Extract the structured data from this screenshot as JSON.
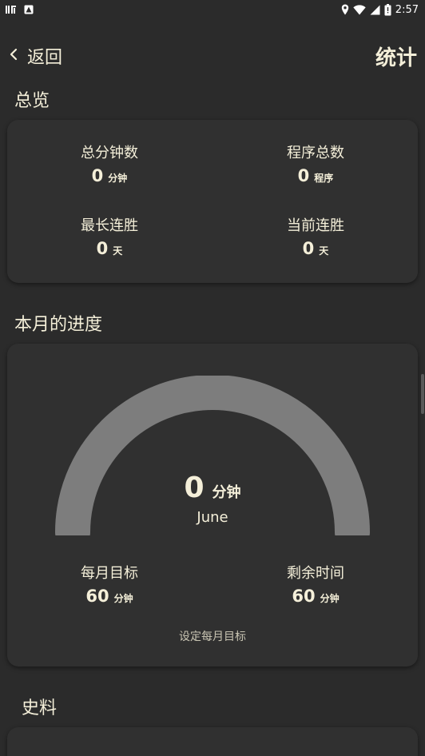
{
  "status_bar": {
    "time": "2:57",
    "left_icons": [
      "listen-app-icon",
      "notification-icon"
    ],
    "right_icons": [
      "location-icon",
      "wifi-icon",
      "signal-icon",
      "battery-icon"
    ]
  },
  "top_bar": {
    "back_label": "返回",
    "title": "统计"
  },
  "overview": {
    "heading": "总览",
    "stats": [
      {
        "label": "总分钟数",
        "value": "0",
        "unit": "分钟"
      },
      {
        "label": "程序总数",
        "value": "0",
        "unit": "程序"
      },
      {
        "label": "最长连胜",
        "value": "0",
        "unit": "天"
      },
      {
        "label": "当前连胜",
        "value": "0",
        "unit": "天"
      }
    ]
  },
  "monthly_progress": {
    "heading": "本月的进度",
    "gauge": {
      "value": "0",
      "unit": "分钟",
      "month": "June",
      "progress_fraction": 0,
      "track_color": "#7d7d7d"
    },
    "goal": {
      "label": "每月目标",
      "value": "60",
      "unit": "分钟"
    },
    "remaining": {
      "label": "剩余时间",
      "value": "60",
      "unit": "分钟"
    },
    "set_goal_link": "设定每月目标"
  },
  "history": {
    "heading": "史料"
  },
  "colors": {
    "background": "#2b2b2b",
    "card": "#303030",
    "text": "#f4efd9"
  }
}
